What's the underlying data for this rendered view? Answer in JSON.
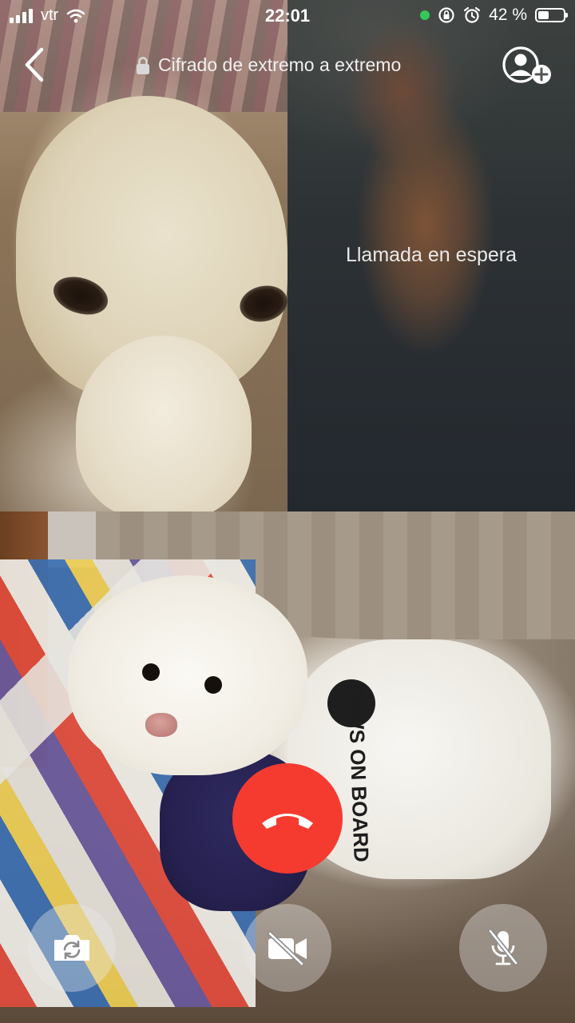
{
  "status_bar": {
    "carrier": "vtr",
    "time": "22:01",
    "battery_percent": "42 %",
    "battery_level": 0.42,
    "icons": [
      "signal-icon",
      "wifi-icon",
      "camera-in-use-dot",
      "rotation-lock-icon",
      "alarm-icon",
      "battery-icon"
    ]
  },
  "call_header": {
    "encryption_label": "Cifrado de extremo a extremo",
    "icons": [
      "back-chevron-icon",
      "lock-icon",
      "add-participant-icon"
    ]
  },
  "participants": {
    "waiting_label": "Llamada en espera"
  },
  "controls": {
    "icons": [
      "end-call-icon",
      "flip-camera-icon",
      "video-off-icon",
      "mic-off-icon"
    ],
    "colors": {
      "end_call": "#f53b30",
      "control_bg": "rgba(235,235,235,0.38)"
    }
  },
  "scene": {
    "sweater_text": "PAWS ON BOARD"
  }
}
